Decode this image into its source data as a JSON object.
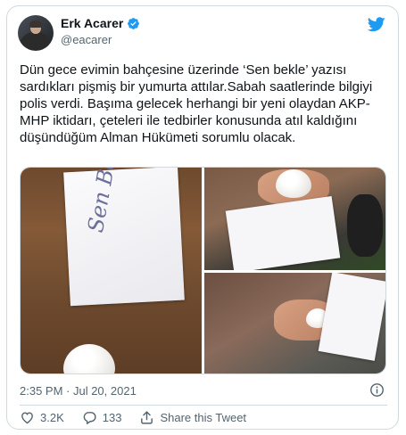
{
  "author": {
    "display_name": "Erk Acarer",
    "handle": "@eacarer",
    "verified": true
  },
  "tweet": {
    "text": "Dün gece evimin bahçesine üzerinde ‘Sen bekle’ yazısı sardıkları pişmiş bir yumurta attılar.Sabah saatlerinde bilgiyi polis verdi. Başıma gelecek herhangi bir yeni olaydan AKP-MHP iktidarı, çeteleri ile tedbirler konusunda atıl kaldığını düşündüğüm Alman Hükümeti sorumlu olacak.",
    "timestamp": "2:35 PM · Jul 20, 2021"
  },
  "media": {
    "photo_count": 3,
    "note_text": "Sen Bekle"
  },
  "actions": {
    "likes": "3.2K",
    "replies": "133",
    "share_label": "Share this Tweet"
  },
  "icons": {
    "brand": "twitter-bird-icon",
    "verified": "verified-badge-icon",
    "info": "info-icon",
    "like": "heart-icon",
    "reply": "reply-icon",
    "share": "share-icon"
  },
  "colors": {
    "brand_blue": "#1d9bf0",
    "text_primary": "#0f1419",
    "text_secondary": "#536471",
    "border": "#cfd9de"
  }
}
